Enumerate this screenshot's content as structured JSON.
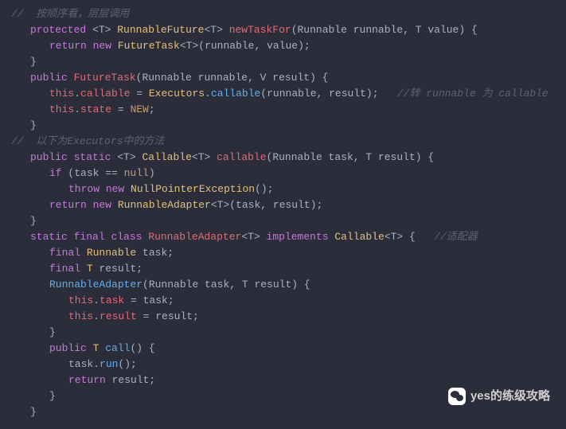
{
  "code": {
    "l1": "//  按顺序看，层层调用",
    "l2": {
      "k1": "protected",
      "g1": "<T> ",
      "t1": "RunnableFuture",
      "g2": "<T> ",
      "m": "newTaskFor",
      "p": "(Runnable runnable, T value) {"
    },
    "l3": {
      "k1": "return",
      "k2": "new",
      "t": "FutureTask",
      "g": "<T>",
      "p": "(runnable, value);"
    },
    "l4": "}",
    "l5": {
      "k1": "public",
      "m": "FutureTask",
      "p": "(Runnable runnable, V result) {"
    },
    "l6": {
      "th": "this",
      "dot": ".",
      "prop": "callable",
      "eq": " = ",
      "t": "Executors",
      "dot2": ".",
      "m": "callable",
      "p": "(runnable, result);   ",
      "c": "//转 runnable 为 callable"
    },
    "l7": {
      "th": "this",
      "dot": ".",
      "prop": "state",
      "eq": " = ",
      "c": "NEW",
      "sc": ";"
    },
    "l8": "}",
    "l9": "//  以下为Executors中的方法",
    "l10": {
      "k1": "public",
      "k2": "static",
      "g1": "<T> ",
      "t": "Callable",
      "g2": "<T> ",
      "m": "callable",
      "p": "(Runnable task, T result) {"
    },
    "l11": {
      "k": "if",
      "p": " (task == ",
      "n": "null",
      "p2": ")"
    },
    "l12": {
      "k1": "throw",
      "k2": "new",
      "t": "NullPointerException",
      "p": "();"
    },
    "l13": {
      "k1": "return",
      "k2": "new",
      "t": "RunnableAdapter",
      "g": "<T>",
      "p": "(task, result);"
    },
    "l14": "}",
    "l15": {
      "k1": "static",
      "k2": "final",
      "k3": "class",
      "t": "RunnableAdapter",
      "g": "<T>",
      "k4": "implements",
      "t2": "Callable",
      "g2": "<T>",
      "b": " {   ",
      "c": "//适配器"
    },
    "l16": {
      "k": "final",
      "t": "Runnable",
      "v": " task;"
    },
    "l17": {
      "k": "final",
      "t": "T",
      "v": " result;"
    },
    "l18": {
      "m": "RunnableAdapter",
      "p": "(Runnable task, T result) {"
    },
    "l19": {
      "th": "this",
      "dot": ".",
      "prop": "task",
      "eq": " = task;"
    },
    "l20": {
      "th": "this",
      "dot": ".",
      "prop": "result",
      "eq": " = result;"
    },
    "l21": "}",
    "l22": {
      "k": "public",
      "t": "T",
      "m": "call",
      "p": "() {"
    },
    "l23": {
      "v": "task.",
      "m": "run",
      "p": "();"
    },
    "l24": {
      "k": "return",
      "v": " result;"
    },
    "l25": "}",
    "l26": "}"
  },
  "watermark": "yes的练级攻略"
}
